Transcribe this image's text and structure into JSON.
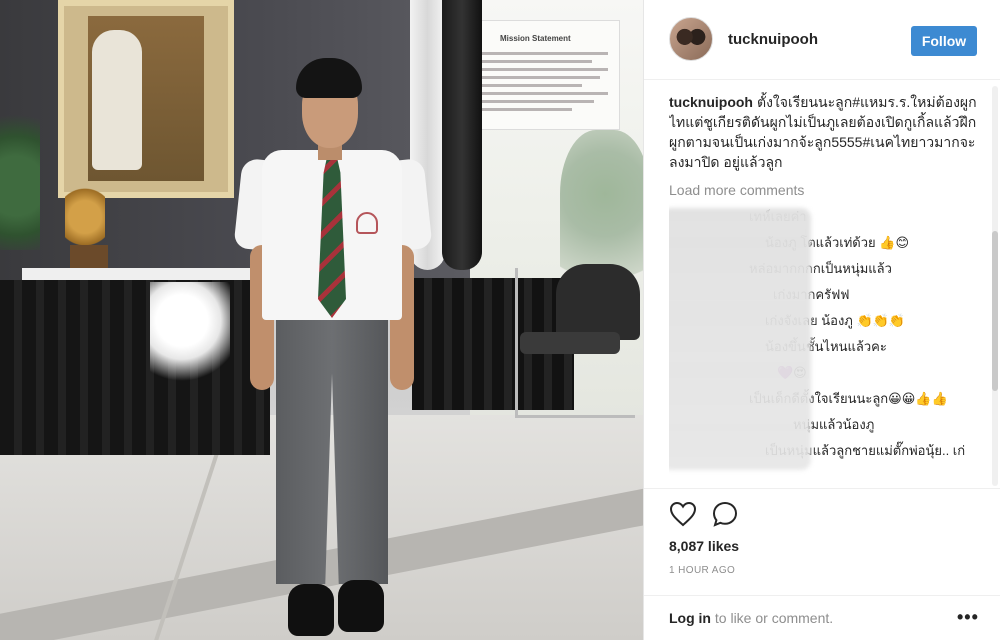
{
  "post": {
    "username": "tucknuipooh",
    "follow_label": "Follow",
    "caption_user": "tucknuipooh",
    "caption_text": "ตั้งใจเรียนนะลูก#แหมร.ร.ใหม่ต้องผูกไทแต่ชูเกียรติดันผูกไม่เป็นภูเลยต้องเปิดกูเกิ้ลแล้วฝึกผูกตามจนเป็นเก่งมากจ้ะลูก5555#เนคไทยาวมากจะลงมาปิด อยู่แล้วลูก",
    "load_more_label": "Load more comments",
    "comments": [
      "เทห์เลยค่า",
      "น้องภู โตแล้วเท่ด้วย 👍😊",
      "หล่อมากกกกเป็นหนุ่มแล้ว",
      "เก่งมากครัฟฟ",
      "เก่งจังเลย น้องภู 👏👏👏",
      "น้องขึ้นชั้นไหนแล้วคะ",
      "💜😍",
      "เป็นเด็กดีตั้งใจเรียนนะลูก😀😀👍👍",
      "หนุ่มแล้วน้องภู",
      "เป็นหนุ่มแล้วลูกชายแม่ตั๊กพ่อนุ้ย.. เก่"
    ],
    "likes": "8,087 likes",
    "time": "1 HOUR AGO",
    "login_link": "Log in",
    "login_rest": " to like or comment.",
    "more_label": "•••"
  },
  "photo": {
    "mission_title": "Mission Statement"
  },
  "colors": {
    "follow_bg": "#3d8ad2",
    "muted": "#8e8e8e",
    "text": "#262626"
  },
  "icons": {
    "like": "heart-icon",
    "comment": "comment-icon",
    "more": "more-options-icon"
  }
}
